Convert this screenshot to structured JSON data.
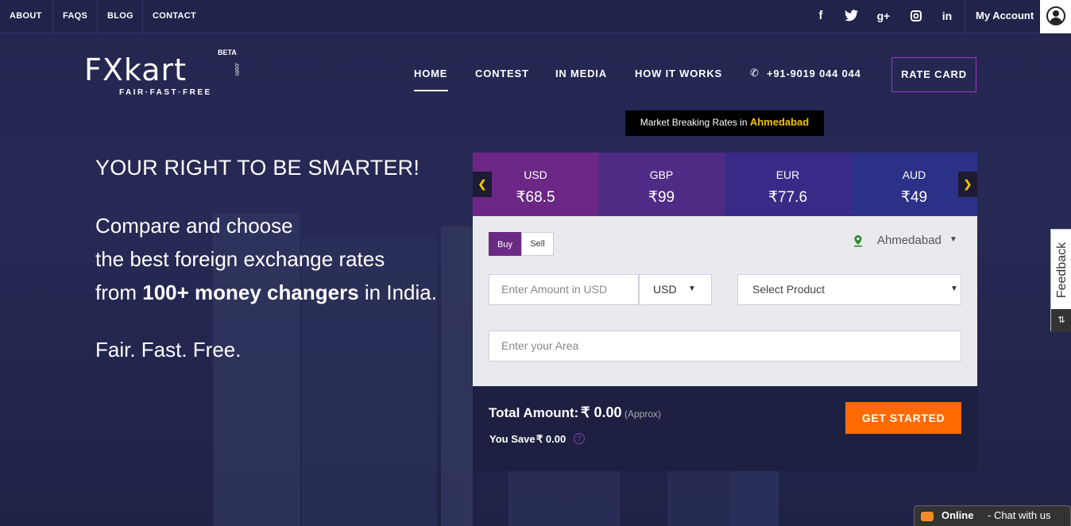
{
  "topbar": {
    "links": [
      "ABOUT",
      "FAQS",
      "BLOG",
      "CONTACT"
    ],
    "social": [
      "facebook-icon",
      "twitter-icon",
      "googleplus-icon",
      "instagram-icon",
      "linkedin-icon"
    ],
    "social_glyphs": [
      "f",
      "🐦",
      "g+",
      "◎",
      "in"
    ],
    "account_label": "My Account"
  },
  "logo": {
    "text": "FXkart",
    "beta": "BETA",
    "com": ".com",
    "tagline": "FAIR·FAST·FREE"
  },
  "nav": {
    "items": [
      "HOME",
      "CONTEST",
      "IN MEDIA",
      "HOW IT WORKS"
    ],
    "phone": "+91-9019 044 044",
    "rate_card": "RATE CARD"
  },
  "market": {
    "prefix": "Market Breaking Rates in ",
    "city": "Ahmedabad"
  },
  "hero": {
    "title": "YOUR RIGHT TO BE SMARTER!",
    "line1": "Compare and choose",
    "line2": "the best foreign exchange rates",
    "line3_pre": "from ",
    "line3_bold": "100+ money changers",
    "line3_post": " in India.",
    "tagline": "Fair. Fast. Free."
  },
  "currencies": [
    {
      "code": "USD",
      "rate": "₹68.5",
      "color": "#6b2686"
    },
    {
      "code": "GBP",
      "rate": "₹99",
      "color": "#4f2b86"
    },
    {
      "code": "EUR",
      "rate": "₹77.6",
      "color": "#3a2a88"
    },
    {
      "code": "AUD",
      "rate": "₹49",
      "color": "#2c3188"
    }
  ],
  "form": {
    "buy": "Buy",
    "sell": "Sell",
    "city": "Ahmedabad",
    "amount_placeholder": "Enter Amount in USD",
    "currency_selected": "USD",
    "product_placeholder": "Select Product",
    "area_placeholder": "Enter your Area"
  },
  "summary": {
    "total_label": "Total Amount:",
    "total_value": "₹ 0.00",
    "approx": "(Approx)",
    "save_label": "You Save",
    "save_value": "₹ 0.00",
    "help": "?",
    "cta": "GET STARTED"
  },
  "feedback": {
    "label": "Feedback",
    "icon": "⇅"
  },
  "chat": {
    "status": "Online",
    "text": " - Chat with us"
  },
  "colors": {
    "accent_orange": "#ff6a00",
    "accent_purple": "#6c2b83",
    "market_city": "#f2c200",
    "background": "#24264f"
  }
}
